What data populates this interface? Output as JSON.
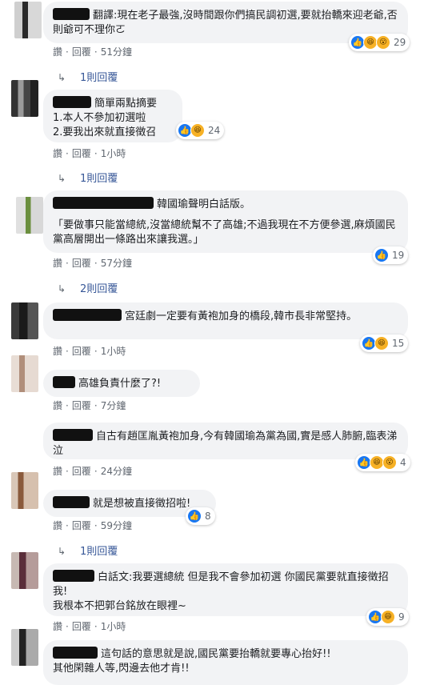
{
  "actions": {
    "like": "讚",
    "reply": "回覆",
    "sep": "·"
  },
  "comments": [
    {
      "text": "翻譯:現在老子最強,沒時間跟你們搞民調初選,要就抬轎來迎老爺,否則爺可不理你ㄛ",
      "time": "51分鐘",
      "reactions": {
        "count": "29",
        "icons": [
          "like-icon",
          "haha-icon",
          "wow-icon"
        ]
      },
      "replies_label": "1則回覆"
    },
    {
      "text_lines": [
        "簡單兩點摘要",
        "1.本人不參加初選啦",
        "2.要我出來就直接徵召"
      ],
      "time": "1小時",
      "reactions": {
        "count": "24",
        "icons": [
          "like-icon",
          "haha-icon"
        ]
      },
      "replies_label": "1則回覆"
    },
    {
      "text": "韓國瑜聲明白話版。",
      "quote": "「要做事只能當總統,沒當總統幫不了高雄;不過我現在不方便參選,麻煩國民黨高層開出一條路出來讓我選。」",
      "time": "57分鐘",
      "reactions": {
        "count": "19",
        "icons": [
          "like-icon"
        ]
      },
      "replies_label": "2則回覆"
    },
    {
      "text": "宮廷劇一定要有黃袍加身的橋段,韓市長非常堅持。",
      "time": "1小時",
      "reactions": {
        "count": "15",
        "icons": [
          "like-icon",
          "haha-icon"
        ]
      }
    },
    {
      "text": "高雄負責什麼了?!",
      "time": "7分鐘"
    },
    {
      "text": "自古有趙匡胤黃袍加身,今有韓國瑜為黨為國,實是感人肺腑,臨表涕泣",
      "time": "24分鐘",
      "reactions": {
        "count": "4",
        "icons": [
          "like-icon",
          "haha-icon",
          "wow-icon"
        ]
      }
    },
    {
      "text": "就是想被直接徵招啦!",
      "time": "59分鐘",
      "reactions": {
        "count": "8",
        "icons": [
          "like-icon"
        ]
      },
      "replies_label": "1則回覆"
    },
    {
      "text": "白話文:我要選總統 但是我不會參加初選 你國民黨要就直接徵招我!",
      "text2": "我根本不把郭台銘放在眼裡~",
      "time": "1小時",
      "reactions": {
        "count": "9",
        "icons": [
          "like-icon",
          "haha-icon"
        ]
      }
    },
    {
      "text": "這句話的意思就是說,國民黨要抬轎就要專心抬好!!",
      "text2": "其他閑雜人等,閃邊去他才肯!!"
    }
  ],
  "colors": {
    "bubble": "#f2f3f5",
    "link": "#385898",
    "like": "#1877f2",
    "haha": "#f7b125"
  }
}
